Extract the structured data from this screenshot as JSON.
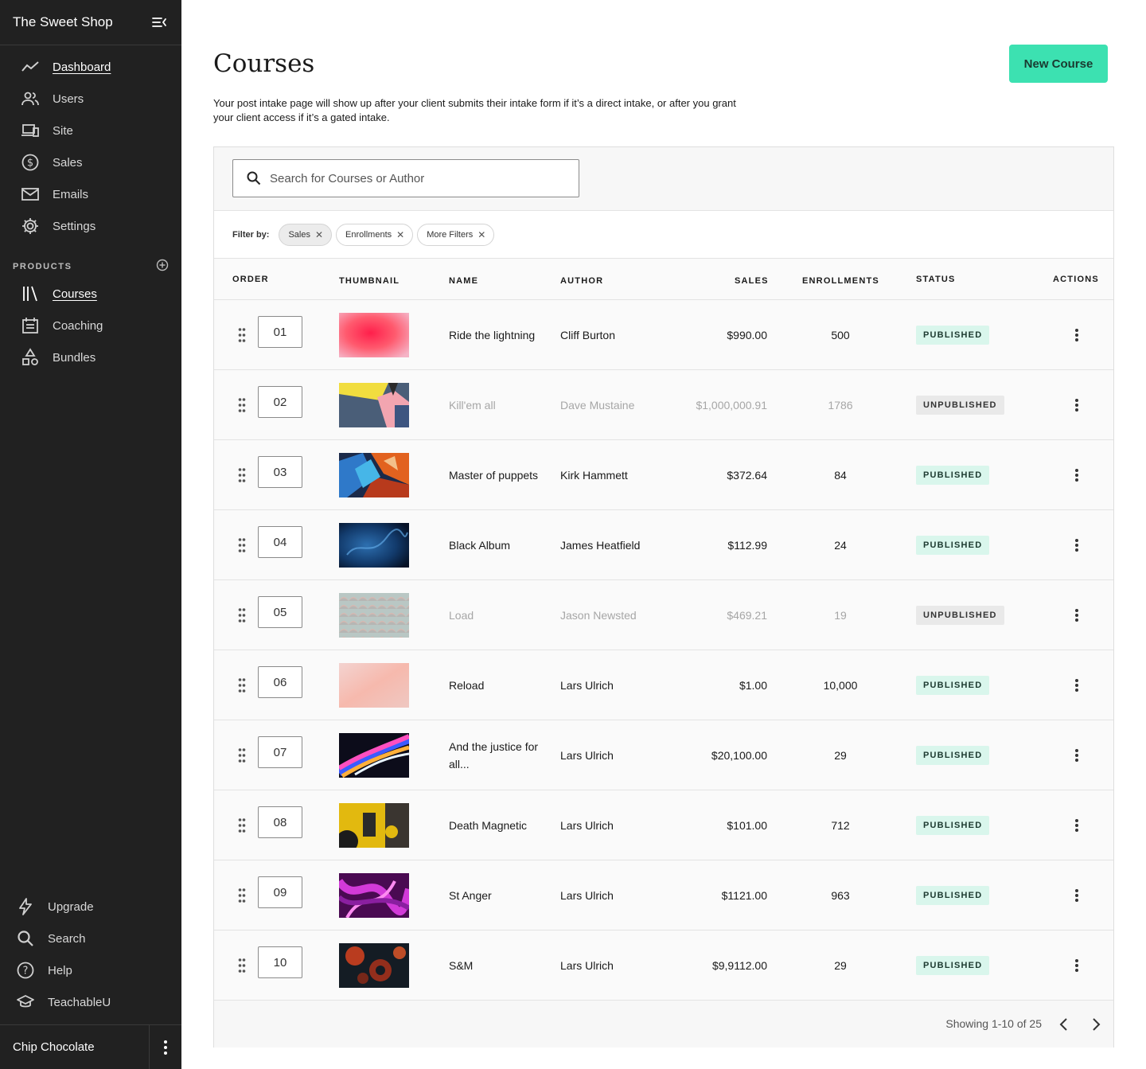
{
  "app": {
    "title": "The Sweet Shop"
  },
  "nav": [
    {
      "label": "Dashboard",
      "icon": "trend-icon",
      "active": true
    },
    {
      "label": "Users",
      "icon": "users-icon"
    },
    {
      "label": "Site",
      "icon": "devices-icon"
    },
    {
      "label": "Sales",
      "icon": "dollar-icon"
    },
    {
      "label": "Emails",
      "icon": "mail-icon"
    },
    {
      "label": "Settings",
      "icon": "gear-icon"
    }
  ],
  "products_section": {
    "label": "PRODUCTS"
  },
  "products": [
    {
      "label": "Courses",
      "icon": "library-icon",
      "active": true
    },
    {
      "label": "Coaching",
      "icon": "calendar-icon"
    },
    {
      "label": "Bundles",
      "icon": "shapes-icon"
    }
  ],
  "bottom_nav": [
    {
      "label": "Upgrade",
      "icon": "bolt-icon"
    },
    {
      "label": "Search",
      "icon": "search-icon"
    },
    {
      "label": "Help",
      "icon": "help-icon"
    },
    {
      "label": "TeachableU",
      "icon": "graduation-cap-icon"
    }
  ],
  "user": {
    "name": "Chip Chocolate"
  },
  "page": {
    "title": "Courses",
    "description": "Your post intake page will show up after your client submits their intake form if it’s a direct intake, or after you grant your client access if it’s a gated intake.",
    "new_button": "New Course"
  },
  "search": {
    "placeholder": "Search for Courses or Author"
  },
  "filters": {
    "label": "Filter by:",
    "chips": [
      {
        "label": "Sales",
        "active": true
      },
      {
        "label": "Enrollments"
      },
      {
        "label": "More Filters"
      }
    ]
  },
  "table": {
    "headers": {
      "order": "ORDER",
      "thumbnail": "THUMBNAIL",
      "name": "NAME",
      "author": "AUTHOR",
      "sales": "SALES",
      "enrollments": "ENROLLMENTS",
      "status": "STATUS",
      "actions": "ACTIONS"
    },
    "rows": [
      {
        "order": "01",
        "name": "Ride the lightning",
        "author": "Cliff Burton",
        "sales": "$990.00",
        "enrollments": "500",
        "status": "PUBLISHED"
      },
      {
        "order": "02",
        "name": "Kill'em all",
        "author": "Dave Mustaine",
        "sales": "$1,000,000.91",
        "enrollments": "1786",
        "status": "UNPUBLISHED"
      },
      {
        "order": "03",
        "name": "Master of puppets",
        "author": "Kirk Hammett",
        "sales": "$372.64",
        "enrollments": "84",
        "status": "PUBLISHED"
      },
      {
        "order": "04",
        "name": "Black Album",
        "author": "James Heatfield",
        "sales": "$112.99",
        "enrollments": "24",
        "status": "PUBLISHED"
      },
      {
        "order": "05",
        "name": "Load",
        "author": "Jason Newsted",
        "sales": "$469.21",
        "enrollments": "19",
        "status": "UNPUBLISHED"
      },
      {
        "order": "06",
        "name": "Reload",
        "author": "Lars Ulrich",
        "sales": "$1.00",
        "enrollments": "10,000",
        "status": "PUBLISHED"
      },
      {
        "order": "07",
        "name": "And the justice for all...",
        "author": "Lars Ulrich",
        "sales": "$20,100.00",
        "enrollments": "29",
        "status": "PUBLISHED"
      },
      {
        "order": "08",
        "name": "Death Magnetic",
        "author": "Lars Ulrich",
        "sales": "$101.00",
        "enrollments": "712",
        "status": "PUBLISHED"
      },
      {
        "order": "09",
        "name": "St Anger",
        "author": "Lars Ulrich",
        "sales": "$1121.00",
        "enrollments": "963",
        "status": "PUBLISHED"
      },
      {
        "order": "10",
        "name": "S&M",
        "author": "Lars Ulrich",
        "sales": "$9,9112.00",
        "enrollments": "29",
        "status": "PUBLISHED"
      }
    ]
  },
  "pagination": {
    "text": "Showing 1-10 of 25"
  },
  "colors": {
    "accent": "#3ce1b1",
    "sidebar": "#212121",
    "published_bg": "#d9f6ec",
    "unpublished_bg": "#e9e9e9"
  }
}
